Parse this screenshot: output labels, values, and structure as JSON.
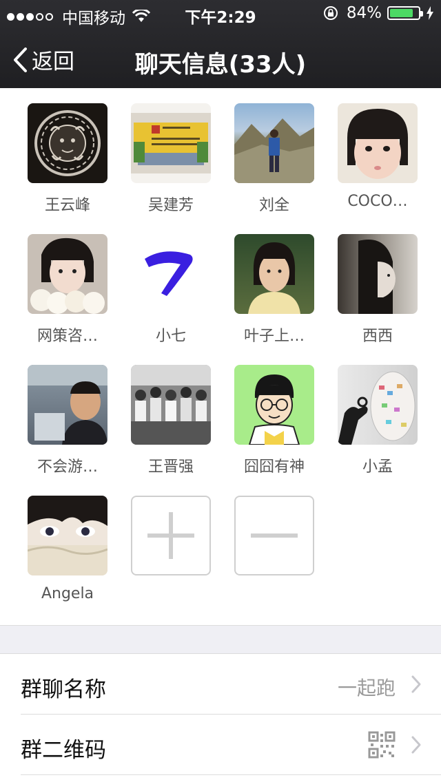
{
  "status_bar": {
    "carrier": "中国移动",
    "time": "下午2:29",
    "battery": "84%",
    "battery_level": 0.84
  },
  "nav": {
    "back_label": "返回",
    "title": "聊天信息(33人)"
  },
  "members": [
    {
      "name": "王云峰",
      "avatar": "versace-medusa-logo"
    },
    {
      "name": "吴建芳",
      "avatar": "office-front-desk-photo"
    },
    {
      "name": "刘全",
      "avatar": "mountain-valley-person-photo"
    },
    {
      "name": "COCO…",
      "avatar": "child-face-photo"
    },
    {
      "name": "网策咨…",
      "avatar": "woman-with-flowers-photo"
    },
    {
      "name": "小七",
      "avatar": "blue-seven-glyph"
    },
    {
      "name": "叶子上…",
      "avatar": "woman-portrait-photo"
    },
    {
      "name": "西西",
      "avatar": "woman-profile-bw-photo"
    },
    {
      "name": "不会游…",
      "avatar": "man-on-bus-photo"
    },
    {
      "name": "王晋强",
      "avatar": "marathon-crowd-bw-photo"
    },
    {
      "name": "囧囧有神",
      "avatar": "cartoon-man-glasses"
    },
    {
      "name": "小孟",
      "avatar": "hand-with-globe-photo"
    },
    {
      "name": "Angela",
      "avatar": "girl-eyes-closeup-photo"
    }
  ],
  "actions": {
    "add_icon": "plus-icon",
    "remove_icon": "minus-icon"
  },
  "settings": [
    {
      "label": "群聊名称",
      "value": "一起跑"
    },
    {
      "label": "群二维码",
      "value_icon": "qr-code-icon"
    }
  ],
  "colors": {
    "nav_bg": "#262629",
    "battery_green": "#4cd964",
    "section_gap": "#efeff4"
  }
}
